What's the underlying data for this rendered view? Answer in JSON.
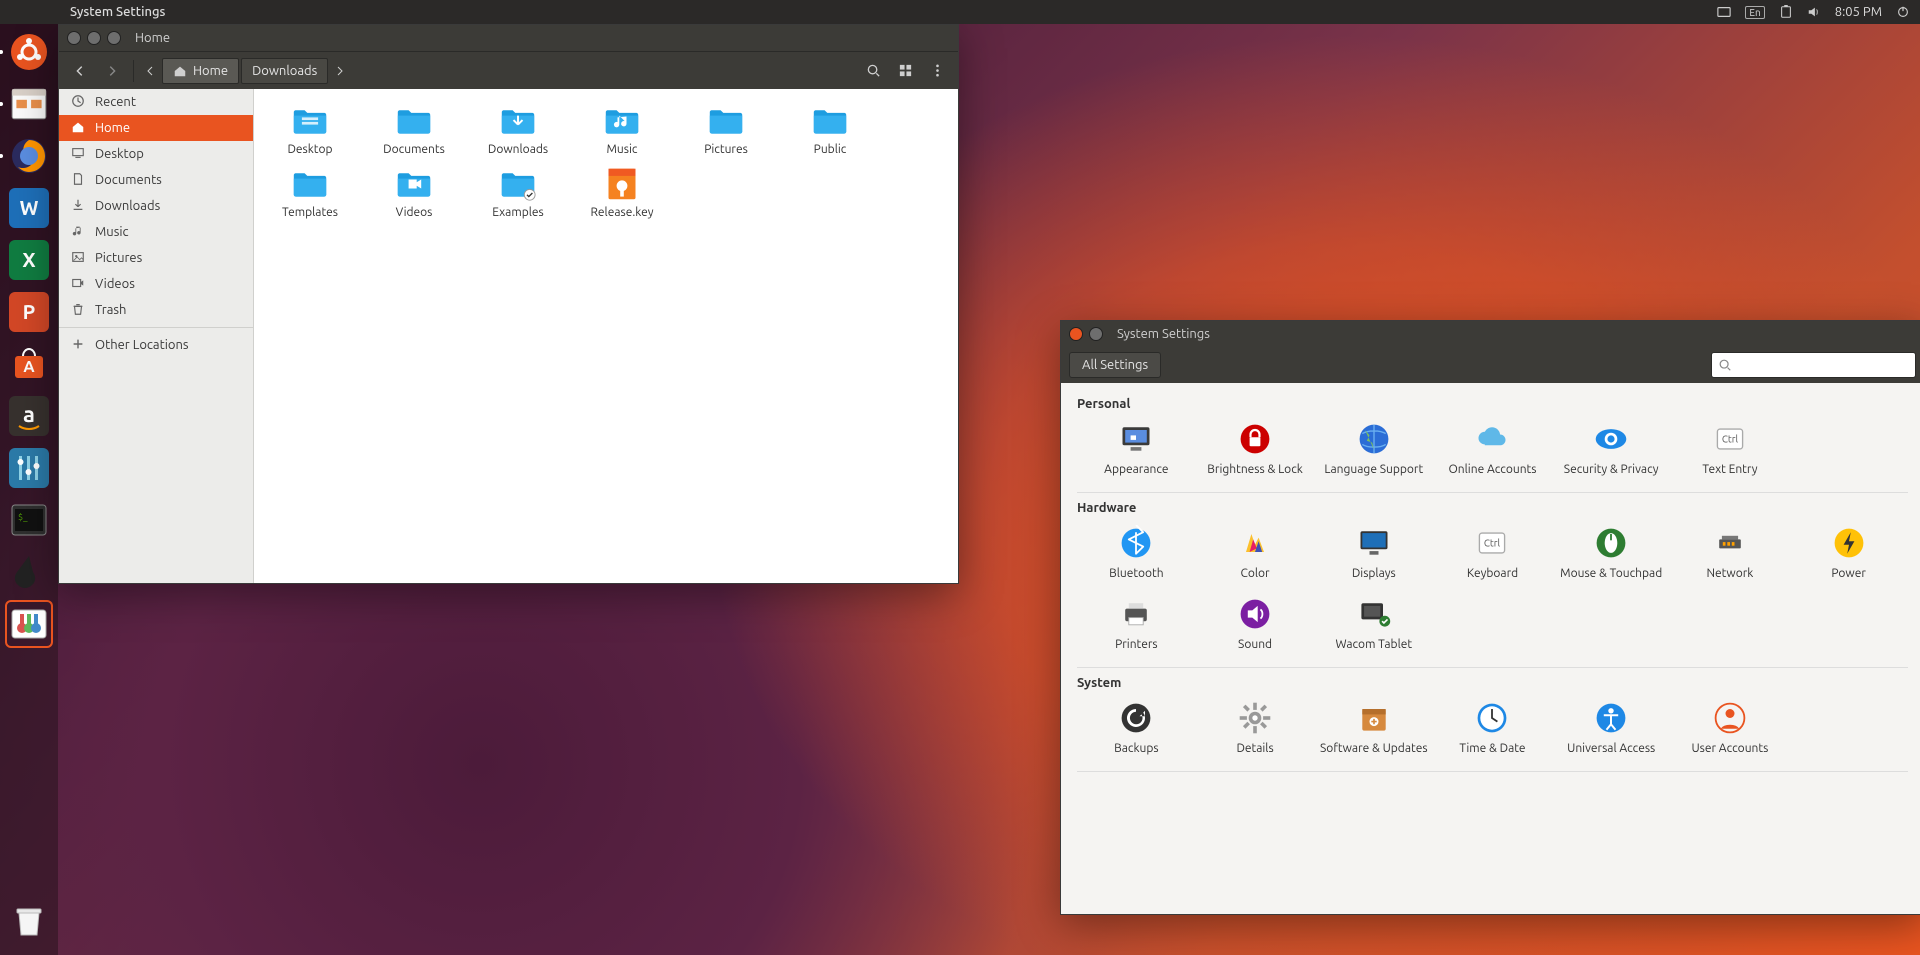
{
  "menubar": {
    "title": "System Settings",
    "time": "8:05 PM",
    "lang": "En"
  },
  "launcher": {
    "items": [
      {
        "name": "ubuntu-dash",
        "color": "#e95420",
        "glyph": "ubuntu"
      },
      {
        "name": "files",
        "color": "#ffffff",
        "glyph": "files"
      },
      {
        "name": "firefox",
        "color": "#2b2b4e",
        "glyph": "firefox"
      },
      {
        "name": "writer",
        "color": "#1e6fb8",
        "glyph": "W"
      },
      {
        "name": "calc",
        "color": "#107c41",
        "glyph": "X"
      },
      {
        "name": "impress",
        "color": "#d24726",
        "glyph": "P"
      },
      {
        "name": "software",
        "color": "#e95420",
        "glyph": "bag"
      },
      {
        "name": "amazon",
        "color": "#2b1b17",
        "glyph": "a"
      },
      {
        "name": "sound-settings",
        "color": "#1c6aa0",
        "glyph": "sliders"
      },
      {
        "name": "terminal",
        "color": "#2f2f2f",
        "glyph": "term"
      },
      {
        "name": "inkscape",
        "color": "#222",
        "glyph": "ink"
      },
      {
        "name": "system-settings",
        "color": "#ffffff",
        "glyph": "settings",
        "active": true
      }
    ]
  },
  "files_window": {
    "title": "Home",
    "breadcrumbs": [
      {
        "label": "Home",
        "is_home": true,
        "active": true
      },
      {
        "label": "Downloads",
        "is_home": false,
        "active": false
      }
    ],
    "sidebar": [
      {
        "icon": "recent",
        "label": "Recent"
      },
      {
        "icon": "home",
        "label": "Home",
        "active": true
      },
      {
        "icon": "desktop",
        "label": "Desktop"
      },
      {
        "icon": "documents",
        "label": "Documents"
      },
      {
        "icon": "downloads",
        "label": "Downloads"
      },
      {
        "icon": "music",
        "label": "Music"
      },
      {
        "icon": "pictures",
        "label": "Pictures"
      },
      {
        "icon": "videos",
        "label": "Videos"
      },
      {
        "icon": "trash",
        "label": "Trash"
      },
      {
        "divider": true
      },
      {
        "icon": "other",
        "label": "Other Locations"
      }
    ],
    "items": [
      {
        "label": "Desktop",
        "kind": "folder-desktop"
      },
      {
        "label": "Documents",
        "kind": "folder"
      },
      {
        "label": "Downloads",
        "kind": "folder-down"
      },
      {
        "label": "Music",
        "kind": "folder-music"
      },
      {
        "label": "Pictures",
        "kind": "folder"
      },
      {
        "label": "Public",
        "kind": "folder"
      },
      {
        "label": "Templates",
        "kind": "folder"
      },
      {
        "label": "Videos",
        "kind": "folder-video"
      },
      {
        "label": "Examples",
        "kind": "folder-link"
      },
      {
        "label": "Release.key",
        "kind": "file-key"
      }
    ]
  },
  "settings_window": {
    "title": "System Settings",
    "all_settings": "All Settings",
    "search_placeholder": "",
    "sections": [
      {
        "title": "Personal",
        "items": [
          {
            "label": "Appearance",
            "icon": "appearance"
          },
          {
            "label": "Brightness & Lock",
            "icon": "lock"
          },
          {
            "label": "Language Support",
            "icon": "globe"
          },
          {
            "label": "Online Accounts",
            "icon": "cloud"
          },
          {
            "label": "Security & Privacy",
            "icon": "eye"
          },
          {
            "label": "Text Entry",
            "icon": "ctrl"
          }
        ]
      },
      {
        "title": "Hardware",
        "items": [
          {
            "label": "Bluetooth",
            "icon": "bluetooth"
          },
          {
            "label": "Color",
            "icon": "color"
          },
          {
            "label": "Displays",
            "icon": "display"
          },
          {
            "label": "Keyboard",
            "icon": "keyboard"
          },
          {
            "label": "Mouse & Touchpad",
            "icon": "mouse"
          },
          {
            "label": "Network",
            "icon": "network"
          },
          {
            "label": "Power",
            "icon": "power"
          },
          {
            "label": "Printers",
            "icon": "printer"
          },
          {
            "label": "Sound",
            "icon": "sound"
          },
          {
            "label": "Wacom Tablet",
            "icon": "wacom"
          }
        ]
      },
      {
        "title": "System",
        "items": [
          {
            "label": "Backups",
            "icon": "backup"
          },
          {
            "label": "Details",
            "icon": "gear"
          },
          {
            "label": "Software & Updates",
            "icon": "package"
          },
          {
            "label": "Time & Date",
            "icon": "clock"
          },
          {
            "label": "Universal Access",
            "icon": "access"
          },
          {
            "label": "User Accounts",
            "icon": "user"
          }
        ]
      }
    ]
  }
}
